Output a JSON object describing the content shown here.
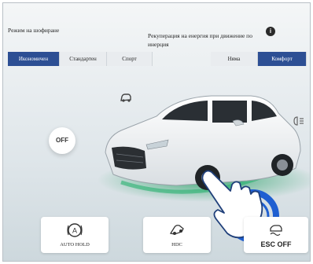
{
  "header": {
    "drive_mode_label": "Режим на шофиране",
    "regen_label": "Рекуперация на енергия при движение по инерция",
    "info_icon": "info-icon"
  },
  "drive_modes": {
    "items": [
      {
        "label": "Икономичен",
        "active": true
      },
      {
        "label": "Стандартен",
        "active": false
      },
      {
        "label": "Спорт",
        "active": false
      }
    ]
  },
  "regen_modes": {
    "items": [
      {
        "label": "Няма",
        "active": false
      },
      {
        "label": "Комфорт",
        "active": true
      }
    ]
  },
  "toggles": {
    "off_label": "OFF"
  },
  "bottom_buttons": {
    "auto_hold": "AUTO HOLD",
    "hdc": "HDC",
    "esc_off": "ESC OFF"
  },
  "colors": {
    "active_tab": "#2d4f94",
    "highlight": "#2ea36a",
    "pointer_ring": "#1f5fd1"
  }
}
